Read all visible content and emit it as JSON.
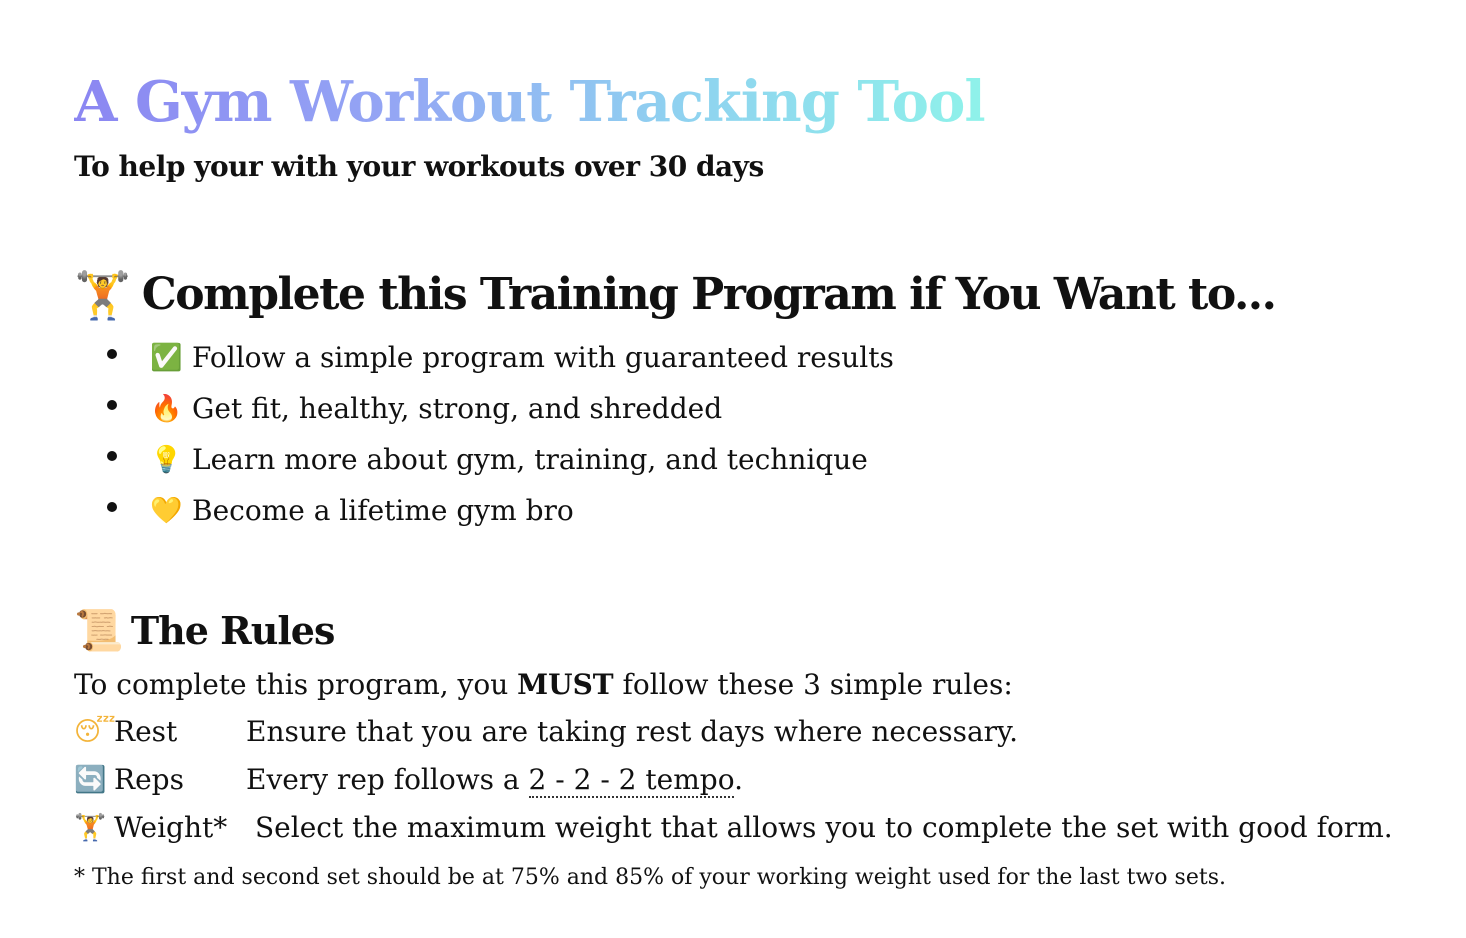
{
  "title": "A Gym Workout Tracking Tool",
  "subtitle": "To help your with your workouts over 30 days",
  "program": {
    "icon": "weightlifter-icon",
    "emoji": "🏋️",
    "heading": "Complete this Training Program if You Want to...",
    "items": [
      {
        "icon": "check-mark-icon",
        "emoji": "✅",
        "text": "Follow a simple program with guaranteed results"
      },
      {
        "icon": "fire-icon",
        "emoji": "🔥",
        "text": "Get fit, healthy, strong, and shredded"
      },
      {
        "icon": "light-bulb-icon",
        "emoji": "💡",
        "text": "Learn more about gym, training, and technique"
      },
      {
        "icon": "yellow-heart-icon",
        "emoji": "💛",
        "text": "Become a lifetime gym bro"
      }
    ]
  },
  "rules": {
    "icon": "scroll-icon",
    "emoji": "📜",
    "heading": "The Rules",
    "intro_before": "To complete this program, you ",
    "intro_bold": "MUST",
    "intro_after": " follow these 3 simple rules:",
    "rows": [
      {
        "icon": "sleeping-face-icon",
        "emoji": "😴",
        "name": "Rest",
        "text": "Ensure that you are taking rest days where necessary."
      },
      {
        "icon": "repeat-icon",
        "emoji": "🔄",
        "name": "Reps",
        "text_before": "Every rep follows a ",
        "link": "2 - 2 - 2 tempo",
        "text_after": "."
      },
      {
        "icon": "weightlifter-icon",
        "emoji": "🏋️",
        "name": "Weight*",
        "text": "Select the maximum weight that allows you to complete the set with good form."
      }
    ],
    "footnote": "* The first and second set should be at 75% and 85% of your working weight used for the last two sets."
  }
}
